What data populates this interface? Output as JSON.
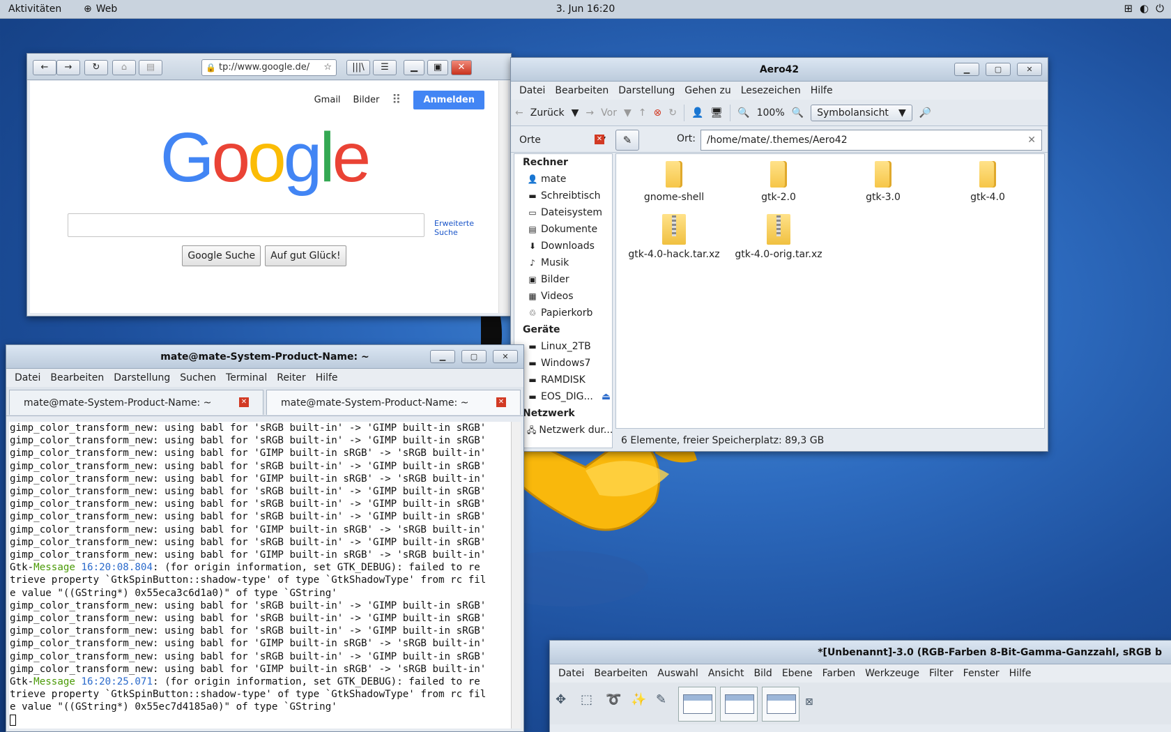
{
  "topbar": {
    "activities": "Aktivitäten",
    "app": "Web",
    "clock": "3. Jun 16:20"
  },
  "firefox": {
    "url": "tp://www.google.de/",
    "google": {
      "gmail": "Gmail",
      "images": "Bilder",
      "signin": "Anmelden",
      "logo": [
        "G",
        "o",
        "o",
        "g",
        "l",
        "e"
      ],
      "logo_colors": [
        "#4285f4",
        "#ea4335",
        "#fbbc05",
        "#4285f4",
        "#34a853",
        "#ea4335"
      ],
      "advanced": "Erweiterte Suche",
      "search_btn": "Google Suche",
      "lucky_btn": "Auf gut Glück!"
    }
  },
  "caja": {
    "title": "Aero42",
    "menu": [
      "Datei",
      "Bearbeiten",
      "Darstellung",
      "Gehen zu",
      "Lesezeichen",
      "Hilfe"
    ],
    "toolbar": {
      "back": "Zurück",
      "forward": "Vor",
      "zoom": "100%",
      "view": "Symbolansicht"
    },
    "places_label": "Orte",
    "location_label": "Ort:",
    "location": "/home/mate/.themes/Aero42",
    "sidebar": {
      "computer": "Rechner",
      "computer_items": [
        "mate",
        "Schreibtisch",
        "Dateisystem",
        "Dokumente",
        "Downloads",
        "Musik",
        "Bilder",
        "Videos",
        "Papierkorb"
      ],
      "devices": "Geräte",
      "device_items": [
        "Linux_2TB",
        "Windows7",
        "RAMDISK",
        "EOS_DIG..."
      ],
      "network": "Netzwerk",
      "network_items": [
        "Netzwerk dur..."
      ]
    },
    "files": [
      {
        "name": "gnome-shell",
        "kind": "folder"
      },
      {
        "name": "gtk-2.0",
        "kind": "folder"
      },
      {
        "name": "gtk-3.0",
        "kind": "folder"
      },
      {
        "name": "gtk-4.0",
        "kind": "folder"
      },
      {
        "name": "gtk-4.0-hack.tar.xz",
        "kind": "archive"
      },
      {
        "name": "gtk-4.0-orig.tar.xz",
        "kind": "archive"
      }
    ],
    "status": "6 Elemente, freier Speicherplatz: 89,3 GB"
  },
  "terminal": {
    "title": "mate@mate-System-Product-Name: ~",
    "menu": [
      "Datei",
      "Bearbeiten",
      "Darstellung",
      "Suchen",
      "Terminal",
      "Reiter",
      "Hilfe"
    ],
    "tabs": [
      "mate@mate-System-Product-Name: ~",
      "mate@mate-System-Product-Name: ~"
    ],
    "lines": [
      "gimp_color_transform_new: using babl for 'sRGB built-in' -> 'GIMP built-in sRGB'",
      "gimp_color_transform_new: using babl for 'sRGB built-in' -> 'GIMP built-in sRGB'",
      "gimp_color_transform_new: using babl for 'GIMP built-in sRGB' -> 'sRGB built-in'",
      "gimp_color_transform_new: using babl for 'sRGB built-in' -> 'GIMP built-in sRGB'",
      "gimp_color_transform_new: using babl for 'GIMP built-in sRGB' -> 'sRGB built-in'",
      "gimp_color_transform_new: using babl for 'sRGB built-in' -> 'GIMP built-in sRGB'",
      "gimp_color_transform_new: using babl for 'sRGB built-in' -> 'GIMP built-in sRGB'",
      "gimp_color_transform_new: using babl for 'sRGB built-in' -> 'GIMP built-in sRGB'",
      "gimp_color_transform_new: using babl for 'GIMP built-in sRGB' -> 'sRGB built-in'",
      "gimp_color_transform_new: using babl for 'sRGB built-in' -> 'GIMP built-in sRGB'",
      "gimp_color_transform_new: using babl for 'GIMP built-in sRGB' -> 'sRGB built-in'",
      {
        "gtk": true,
        "time": "16:20:08.804",
        "rest": ": (for origin information, set GTK_DEBUG): failed to re"
      },
      "trieve property `GtkSpinButton::shadow-type' of type `GtkShadowType' from rc fil",
      "e value \"((GString*) 0x55eca3c6d1a0)\" of type `GString'",
      "gimp_color_transform_new: using babl for 'sRGB built-in' -> 'GIMP built-in sRGB'",
      "gimp_color_transform_new: using babl for 'sRGB built-in' -> 'GIMP built-in sRGB'",
      "gimp_color_transform_new: using babl for 'sRGB built-in' -> 'GIMP built-in sRGB'",
      "gimp_color_transform_new: using babl for 'GIMP built-in sRGB' -> 'sRGB built-in'",
      "gimp_color_transform_new: using babl for 'sRGB built-in' -> 'GIMP built-in sRGB'",
      "gimp_color_transform_new: using babl for 'GIMP built-in sRGB' -> 'sRGB built-in'",
      {
        "gtk": true,
        "time": "16:20:25.071",
        "rest": ": (for origin information, set GTK_DEBUG): failed to re"
      },
      "trieve property `GtkSpinButton::shadow-type' of type `GtkShadowType' from rc fil",
      "e value \"((GString*) 0x55ec7d4185a0)\" of type `GString'"
    ],
    "gtk_prefix": "Gtk-",
    "message_word": "Message"
  },
  "gimp": {
    "title": "*[Unbenannt]-3.0 (RGB-Farben 8-Bit-Gamma-Ganzzahl, sRGB b",
    "menu": [
      "Datei",
      "Bearbeiten",
      "Auswahl",
      "Ansicht",
      "Bild",
      "Ebene",
      "Farben",
      "Werkzeuge",
      "Filter",
      "Fenster",
      "Hilfe"
    ]
  },
  "colors": {
    "accent": "#4285f4",
    "close_red": "#d23a24",
    "folder_yellow": "#f6c648"
  }
}
